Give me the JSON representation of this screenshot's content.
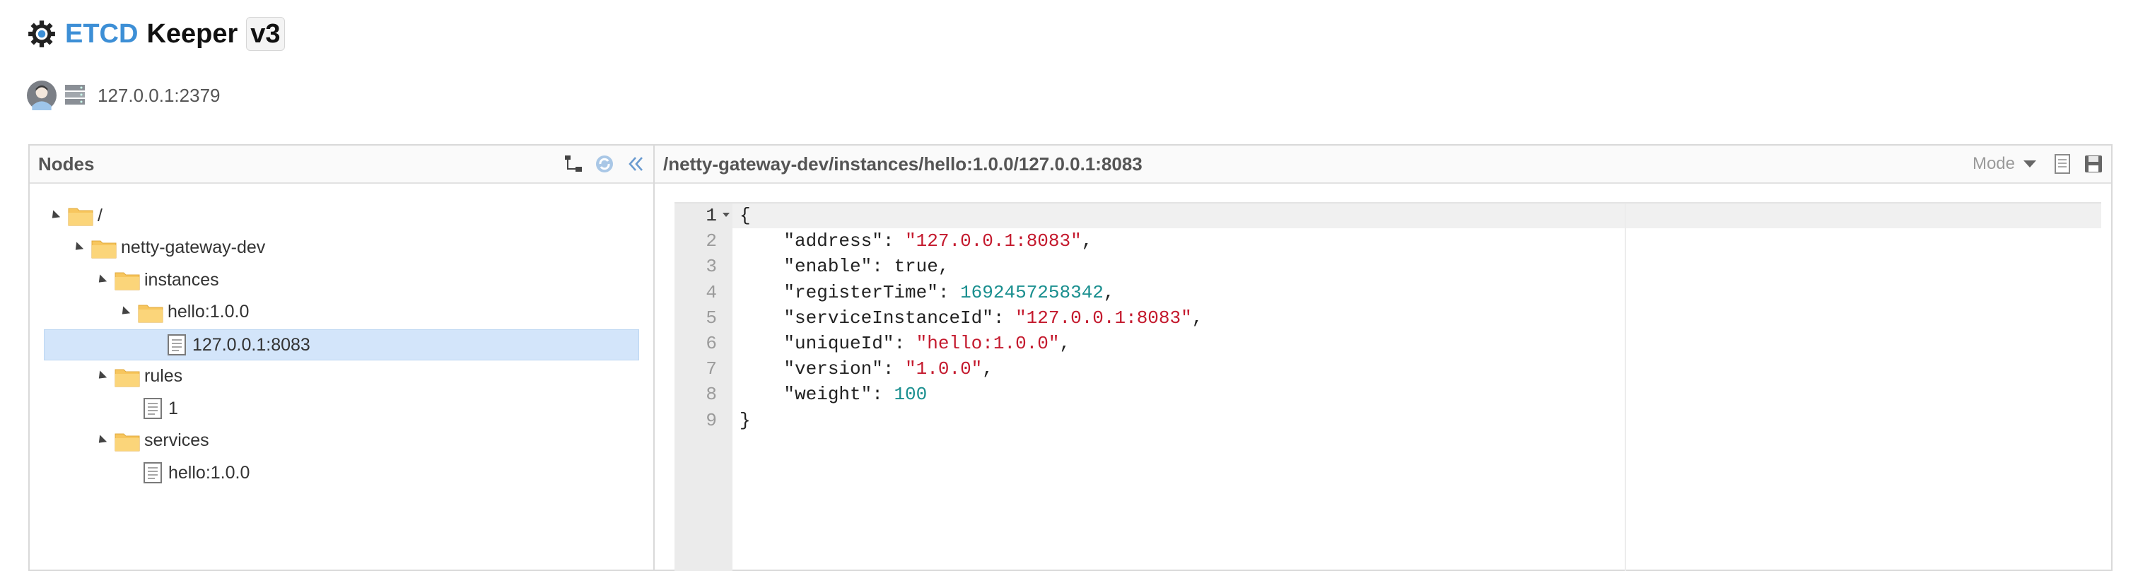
{
  "header": {
    "brand": "ETCD",
    "name": "Keeper",
    "version": "v3",
    "icon": "gear-icon"
  },
  "connection": {
    "avatar_icon": "user-avatar-icon",
    "server_icon": "server-icon",
    "address": "127.0.0.1:2379"
  },
  "nodes_panel": {
    "title": "Nodes",
    "tools": [
      "tree-structure-icon",
      "refresh-icon",
      "collapse-double-chevron-icon"
    ],
    "tree": [
      {
        "label": "/",
        "type": "folder",
        "level": 0,
        "expanded": true
      },
      {
        "label": "netty-gateway-dev",
        "type": "folder",
        "level": 1,
        "expanded": true
      },
      {
        "label": "instances",
        "type": "folder",
        "level": 2,
        "expanded": true
      },
      {
        "label": "hello:1.0.0",
        "type": "folder",
        "level": 3,
        "expanded": true
      },
      {
        "label": "127.0.0.1:8083",
        "type": "file",
        "level": 4,
        "selected": true
      },
      {
        "label": "rules",
        "type": "folder",
        "level": 2,
        "expanded": true
      },
      {
        "label": "1",
        "type": "file",
        "level": 3
      },
      {
        "label": "services",
        "type": "folder",
        "level": 2,
        "expanded": true
      },
      {
        "label": "hello:1.0.0",
        "type": "file",
        "level": 3
      }
    ]
  },
  "editor_panel": {
    "path": "/netty-gateway-dev/instances/hello:1.0.0/127.0.0.1:8083",
    "mode_label": "Mode",
    "tools": [
      "document-icon",
      "save-icon"
    ],
    "lines": [
      [
        {
          "t": "{",
          "c": "p"
        }
      ],
      [
        {
          "t": "    \"address\"",
          "c": "p"
        },
        {
          "t": ": ",
          "c": "p"
        },
        {
          "t": "\"127.0.0.1:8083\"",
          "c": "str"
        },
        {
          "t": ",",
          "c": "p"
        }
      ],
      [
        {
          "t": "    \"enable\"",
          "c": "p"
        },
        {
          "t": ": true,",
          "c": "p"
        }
      ],
      [
        {
          "t": "    \"registerTime\"",
          "c": "p"
        },
        {
          "t": ": ",
          "c": "p"
        },
        {
          "t": "1692457258342",
          "c": "num"
        },
        {
          "t": ",",
          "c": "p"
        }
      ],
      [
        {
          "t": "    \"serviceInstanceId\"",
          "c": "p"
        },
        {
          "t": ": ",
          "c": "p"
        },
        {
          "t": "\"127.0.0.1:8083\"",
          "c": "str"
        },
        {
          "t": ",",
          "c": "p"
        }
      ],
      [
        {
          "t": "    \"uniqueId\"",
          "c": "p"
        },
        {
          "t": ": ",
          "c": "p"
        },
        {
          "t": "\"hello:1.0.0\"",
          "c": "str"
        },
        {
          "t": ",",
          "c": "p"
        }
      ],
      [
        {
          "t": "    \"version\"",
          "c": "p"
        },
        {
          "t": ": ",
          "c": "p"
        },
        {
          "t": "\"1.0.0\"",
          "c": "str"
        },
        {
          "t": ",",
          "c": "p"
        }
      ],
      [
        {
          "t": "    \"weight\"",
          "c": "p"
        },
        {
          "t": ": ",
          "c": "p"
        },
        {
          "t": "100",
          "c": "num"
        }
      ],
      [
        {
          "t": "}",
          "c": "p"
        }
      ]
    ]
  },
  "colors": {
    "brand": "#3d8fd6",
    "selected_row": "#d3e5fa",
    "string": "#c41a2e",
    "number": "#1a8f8f",
    "folder": "#f7c65e"
  }
}
